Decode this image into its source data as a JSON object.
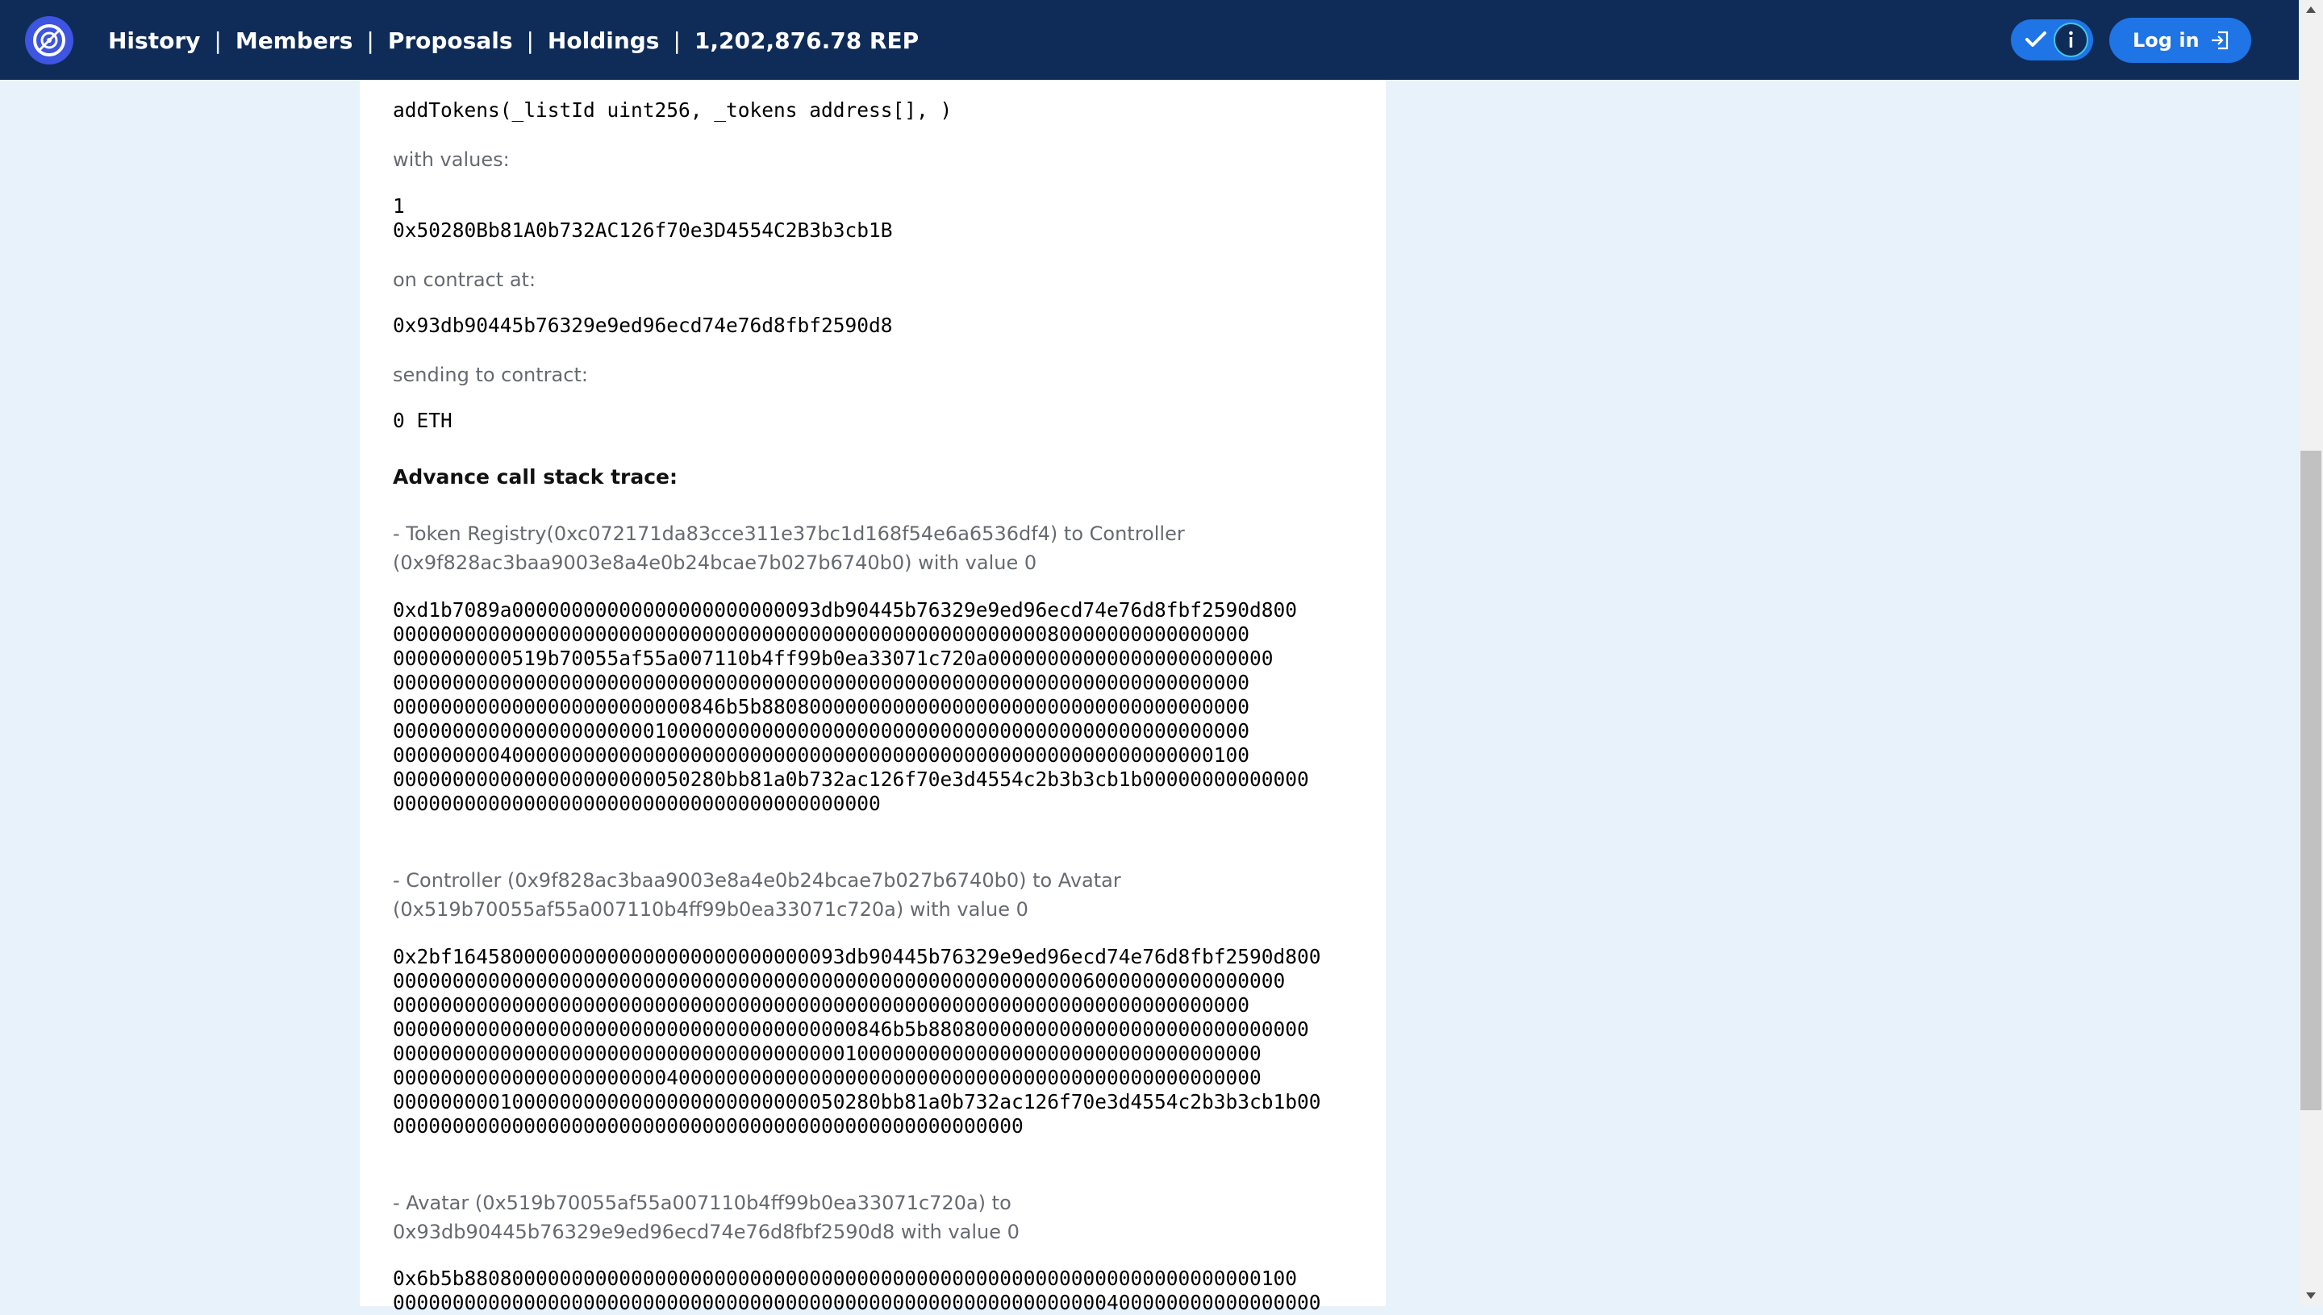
{
  "header": {
    "nav": [
      {
        "label": "History"
      },
      {
        "label": "Members"
      },
      {
        "label": "Proposals"
      },
      {
        "label": "Holdings"
      },
      {
        "label": "1,202,876.78 REP"
      }
    ],
    "separator": "|",
    "login_label": "Log in"
  },
  "proposal": {
    "function_signature": "addTokens(_listId uint256, _tokens address[], )",
    "with_values_label": "with values:",
    "values": [
      "1",
      "0x50280Bb81A0b732AC126f70e3D4554C2B3b3cb1B"
    ],
    "on_contract_label": "on contract at:",
    "contract_address": "0x93db90445b76329e9ed96ecd74e76d8fbf2590d8",
    "sending_label": "sending to contract:",
    "sending_value": "0 ETH",
    "trace_heading": "Advance call stack trace:",
    "traces": [
      {
        "description_line1": "- Token Registry(0xc072171da83cce311e37bc1d168f54e6a6536df4) to Controller",
        "description_line2": "(0x9f828ac3baa9003e8a4e0b24bcae7b027b6740b0) with value 0",
        "data_lines": [
          "0xd1b7089a00000000000000000000000093db90445b76329e9ed96ecd74e76d8fbf2590d800",
          "000000000000000000000000000000000000000000000000000000080000000000000000",
          "0000000000519b70055af55a007110b4ff99b0ea33071c720a000000000000000000000000",
          "000000000000000000000000000000000000000000000000000000000000000000000000",
          "0000000000000000000000000846b5b88080000000000000000000000000000000000000",
          "000000000000000000000010000000000000000000000000000000000000000000000000",
          "000000000400000000000000000000000000000000000000000000000000000000000100",
          "0000000000000000000000050280bb81a0b732ac126f70e3d4554c2b3b3cb1b00000000000000",
          "00000000000000000000000000000000000000000"
        ]
      },
      {
        "description_line1": "- Controller (0x9f828ac3baa9003e8a4e0b24bcae7b027b6740b0) to Avatar",
        "description_line2": "(0x519b70055af55a007110b4ff99b0ea33071c720a) with value 0",
        "data_lines": [
          "0x2bf164580000000000000000000000000093db90445b76329e9ed96ecd74e76d8fbf2590d800",
          "000000000000000000000000000000000000000000000000000000000060000000000000000",
          "000000000000000000000000000000000000000000000000000000000000000000000000",
          "000000000000000000000000000000000000000846b5b88080000000000000000000000000000",
          "0000000000000000000000000000000000000010000000000000000000000000000000000",
          "0000000000000000000000040000000000000000000000000000000000000000000000000",
          "00000000010000000000000000000000000050280bb81a0b732ac126f70e3d4554c2b3b3cb1b00",
          "00000000000000000000000000000000000000000000000000000"
        ]
      },
      {
        "description_line1": "- Avatar (0x519b70055af55a007110b4ff99b0ea33071c720a) to",
        "description_line2": "0x93db90445b76329e9ed96ecd74e76d8fbf2590d8 with value 0",
        "data_lines": [
          "0x6b5b8808000000000000000000000000000000000000000000000000000000000000000100",
          "000000000000000000000000000000000000000000000000000000000000400000000000000000"
        ]
      }
    ]
  },
  "colors": {
    "topbar": "#0e2c57",
    "accent": "#1f74e6",
    "logo": "#3d55e0",
    "page_bg": "#e8f2fb",
    "label_text": "#666a70"
  },
  "icons": [
    "dao-logo-icon",
    "check-icon",
    "info-icon",
    "login-icon",
    "scroll-up-arrow-icon",
    "scroll-down-arrow-icon"
  ]
}
